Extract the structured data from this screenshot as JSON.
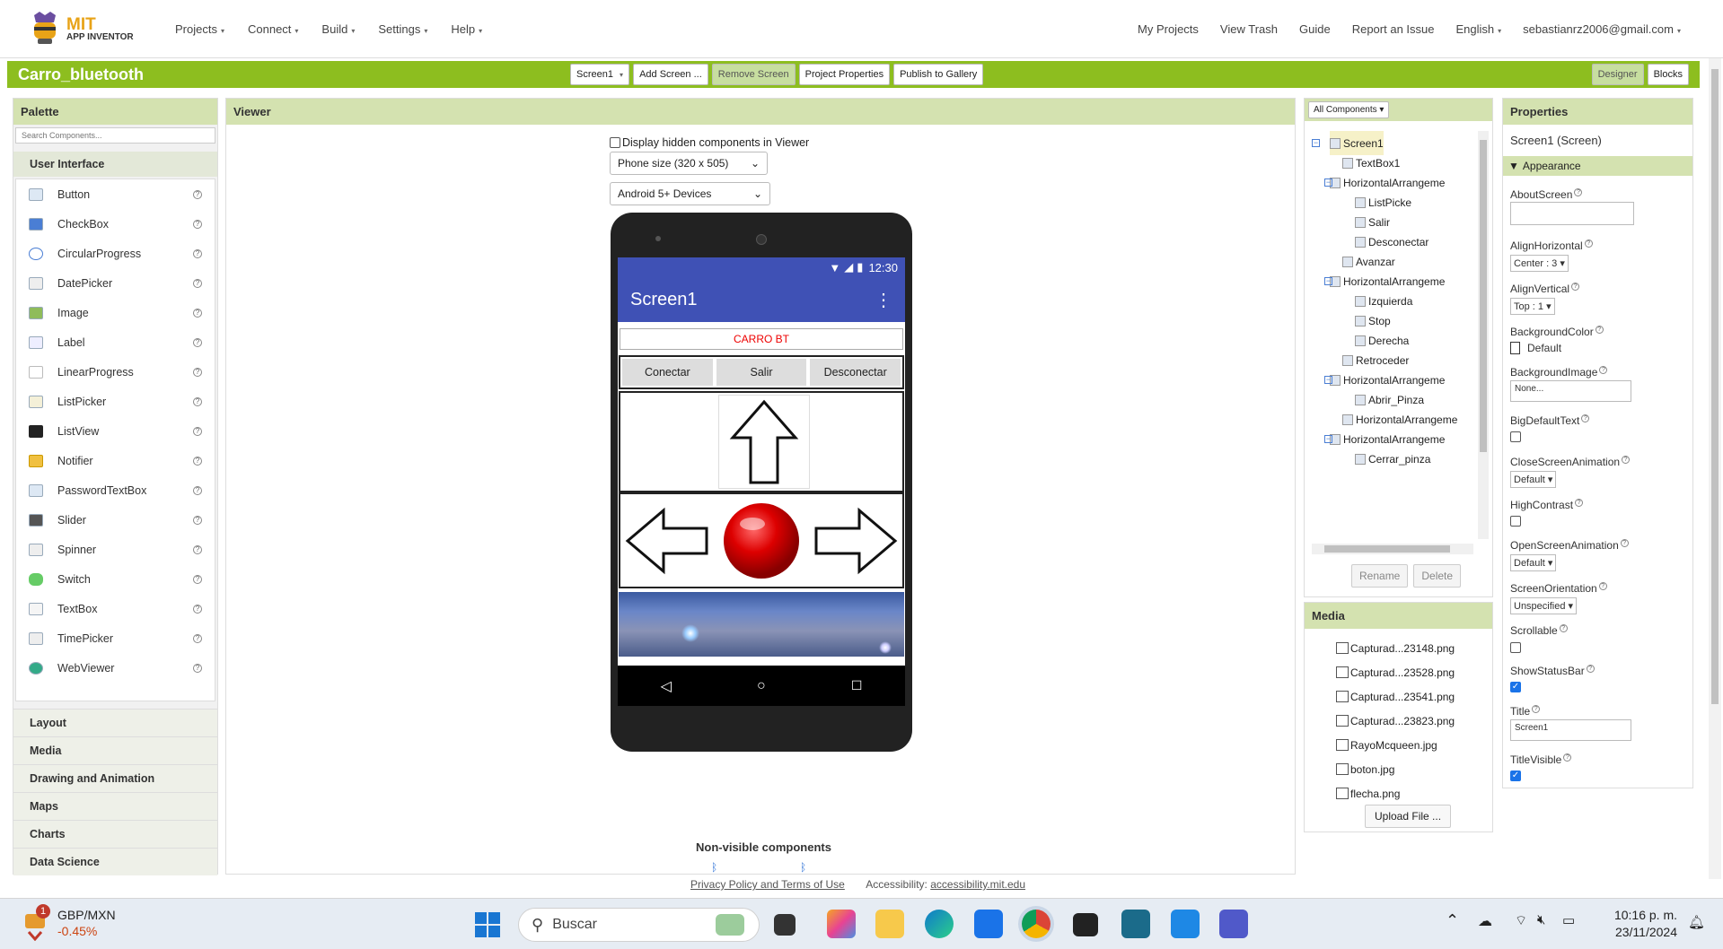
{
  "topnav": {
    "logo_mit": "MIT",
    "logo_sub": "APP INVENTOR",
    "menu": [
      "Projects",
      "Connect",
      "Build",
      "Settings",
      "Help"
    ],
    "right": [
      "My Projects",
      "View Trash",
      "Guide",
      "Report an Issue",
      "English",
      "sebastianrz2006@gmail.com"
    ]
  },
  "project": {
    "name": "Carro_bluetooth",
    "screen_select": "Screen1",
    "add_screen": "Add Screen ...",
    "remove_screen": "Remove Screen",
    "project_properties": "Project Properties",
    "publish": "Publish to Gallery",
    "designer": "Designer",
    "blocks": "Blocks"
  },
  "palette": {
    "title": "Palette",
    "search_placeholder": "Search Components...",
    "category": "User Interface",
    "items": [
      "Button",
      "CheckBox",
      "CircularProgress",
      "DatePicker",
      "Image",
      "Label",
      "LinearProgress",
      "ListPicker",
      "ListView",
      "Notifier",
      "PasswordTextBox",
      "Slider",
      "Spinner",
      "Switch",
      "TextBox",
      "TimePicker",
      "WebViewer"
    ],
    "help_glyph": "?",
    "collapsed": [
      "Layout",
      "Media",
      "Drawing and Animation",
      "Maps",
      "Charts",
      "Data Science"
    ]
  },
  "viewer": {
    "title": "Viewer",
    "hidden_label": "Display hidden components in Viewer",
    "phone_size": "Phone size (320 x 505)",
    "device": "Android 5+ Devices",
    "status_time": "12:30",
    "screen_title": "Screen1",
    "textbox_text": "CARRO BT",
    "buttons": [
      "Conectar",
      "Salir",
      "Desconectar"
    ],
    "nonvisible": "Non-visible components",
    "footer_link": "Privacy Policy and Terms of Use",
    "accessibility_label": "Accessibility:",
    "accessibility_link": "accessibility.mit.edu"
  },
  "components": {
    "dropdown": "All Components",
    "tree": [
      {
        "label": "Screen1",
        "toggle": "⊟"
      },
      {
        "label": "TextBox1"
      },
      {
        "label": "HorizontalArrangeme",
        "toggle": "⊟"
      },
      {
        "label": "ListPicke"
      },
      {
        "label": "Salir"
      },
      {
        "label": "Desconectar"
      },
      {
        "label": "Avanzar"
      },
      {
        "label": "HorizontalArrangeme",
        "toggle": "⊟"
      },
      {
        "label": "Izquierda"
      },
      {
        "label": "Stop"
      },
      {
        "label": "Derecha"
      },
      {
        "label": "Retroceder"
      },
      {
        "label": "HorizontalArrangeme",
        "toggle": "⊟"
      },
      {
        "label": "Abrir_Pinza"
      },
      {
        "label": "HorizontalArrangeme"
      },
      {
        "label": "HorizontalArrangeme",
        "toggle": "⊟"
      },
      {
        "label": "Cerrar_pinza"
      }
    ],
    "rename": "Rename",
    "delete": "Delete"
  },
  "media": {
    "title": "Media",
    "files": [
      "Capturad...23148.png",
      "Capturad...23528.png",
      "Capturad...23541.png",
      "Capturad...23823.png",
      "RayoMcqueen.jpg",
      "boton.jpg",
      "flecha.png"
    ],
    "upload": "Upload File ..."
  },
  "properties": {
    "title": "Properties",
    "subject": "Screen1 (Screen)",
    "group": "Appearance",
    "help_glyph": "?",
    "about_screen": "AboutScreen",
    "align_horizontal": "AlignHorizontal",
    "align_horizontal_value": "Center : 3",
    "align_vertical": "AlignVertical",
    "align_vertical_value": "Top : 1",
    "background_color": "BackgroundColor",
    "background_color_value": "Default",
    "background_image": "BackgroundImage",
    "background_image_value": "None...",
    "big_default_text": "BigDefaultText",
    "close_anim": "CloseScreenAnimation",
    "close_anim_value": "Default",
    "high_contrast": "HighContrast",
    "open_anim": "OpenScreenAnimation",
    "open_anim_value": "Default",
    "orientation": "ScreenOrientation",
    "orientation_value": "Unspecified",
    "scrollable": "Scrollable",
    "show_status_bar": "ShowStatusBar",
    "title_label": "Title",
    "title_value": "Screen1",
    "title_visible": "TitleVisible"
  },
  "taskbar": {
    "badge": "1",
    "pair": "GBP/MXN",
    "change": "-0.45%",
    "search": "Buscar",
    "time": "10:16 p. m.",
    "date": "23/11/2024"
  }
}
